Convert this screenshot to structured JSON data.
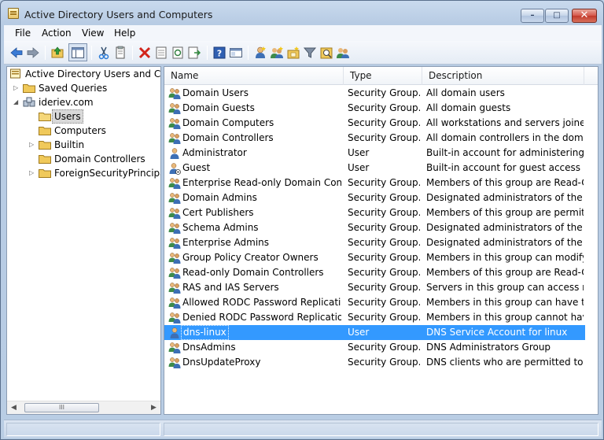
{
  "window": {
    "title": "Active Directory Users and Computers",
    "controls": {
      "minimize": "–",
      "maximize": "□",
      "close": "✕"
    }
  },
  "menu": [
    "File",
    "Action",
    "View",
    "Help"
  ],
  "toolbar": [
    "back-icon",
    "forward-icon",
    "up-folder-icon",
    "show-hide-tree-icon",
    "cut-icon",
    "copy-icon",
    "delete-icon",
    "properties-icon",
    "refresh-icon",
    "export-list-icon",
    "help-icon",
    "console-tree-icon",
    "new-user-icon",
    "new-group-icon",
    "new-ou-icon",
    "filter-icon",
    "find-icon",
    "add-to-group-icon"
  ],
  "tree": {
    "root": "Active Directory Users and Com",
    "items": [
      {
        "label": "Saved Queries",
        "expander": "▷",
        "level": 1
      },
      {
        "label": "ideriev.com",
        "expander": "◢",
        "level": 1
      },
      {
        "label": "Users",
        "expander": "",
        "level": 2,
        "selected": true
      },
      {
        "label": "Computers",
        "expander": "",
        "level": 2
      },
      {
        "label": "Builtin",
        "expander": "▷",
        "level": 2
      },
      {
        "label": "Domain Controllers",
        "expander": "",
        "level": 2
      },
      {
        "label": "ForeignSecurityPrincipals",
        "expander": "▷",
        "level": 2
      }
    ],
    "hscroll": {
      "left": "◀",
      "right": "▶",
      "thumb": "III"
    }
  },
  "list": {
    "columns": [
      "Name",
      "Type",
      "Description"
    ],
    "rows": [
      {
        "name": "Domain Users",
        "type": "Security Group...",
        "desc": "All domain users",
        "icon": "group"
      },
      {
        "name": "Domain Guests",
        "type": "Security Group...",
        "desc": "All domain guests",
        "icon": "group"
      },
      {
        "name": "Domain Computers",
        "type": "Security Group...",
        "desc": "All workstations and servers joined ...",
        "icon": "group"
      },
      {
        "name": "Domain Controllers",
        "type": "Security Group...",
        "desc": "All domain controllers in the domain",
        "icon": "group"
      },
      {
        "name": "Administrator",
        "type": "User",
        "desc": "Built-in account for administering t...",
        "icon": "user"
      },
      {
        "name": "Guest",
        "type": "User",
        "desc": "Built-in account for guest access to ...",
        "icon": "user-disabled"
      },
      {
        "name": "Enterprise Read-only Domain Contr...",
        "type": "Security Group...",
        "desc": "Members of this group are Read-O...",
        "icon": "group"
      },
      {
        "name": "Domain Admins",
        "type": "Security Group...",
        "desc": "Designated administrators of the d...",
        "icon": "group"
      },
      {
        "name": "Cert Publishers",
        "type": "Security Group...",
        "desc": "Members of this group are permitt...",
        "icon": "group"
      },
      {
        "name": "Schema Admins",
        "type": "Security Group...",
        "desc": "Designated administrators of the sc...",
        "icon": "group"
      },
      {
        "name": "Enterprise Admins",
        "type": "Security Group...",
        "desc": "Designated administrators of the e...",
        "icon": "group"
      },
      {
        "name": "Group Policy Creator Owners",
        "type": "Security Group...",
        "desc": "Members in this group can modify ...",
        "icon": "group"
      },
      {
        "name": "Read-only Domain Controllers",
        "type": "Security Group...",
        "desc": "Members of this group are Read-O...",
        "icon": "group"
      },
      {
        "name": "RAS and IAS Servers",
        "type": "Security Group...",
        "desc": "Servers in this group can access re...",
        "icon": "group"
      },
      {
        "name": "Allowed RODC Password Replication...",
        "type": "Security Group...",
        "desc": "Members in this group can have th...",
        "icon": "group"
      },
      {
        "name": "Denied RODC Password Replication ...",
        "type": "Security Group...",
        "desc": "Members in this group cannot hav...",
        "icon": "group"
      },
      {
        "name": "dns-linux",
        "type": "User",
        "desc": "DNS Service Account for linux",
        "icon": "user",
        "selected": true
      },
      {
        "name": "DnsAdmins",
        "type": "Security Group...",
        "desc": "DNS Administrators Group",
        "icon": "group"
      },
      {
        "name": "DnsUpdateProxy",
        "type": "Security Group...",
        "desc": "DNS clients who are permitted to p...",
        "icon": "group"
      }
    ]
  },
  "colors": {
    "selection": "#3399ff",
    "frame": "#b9cde4"
  }
}
